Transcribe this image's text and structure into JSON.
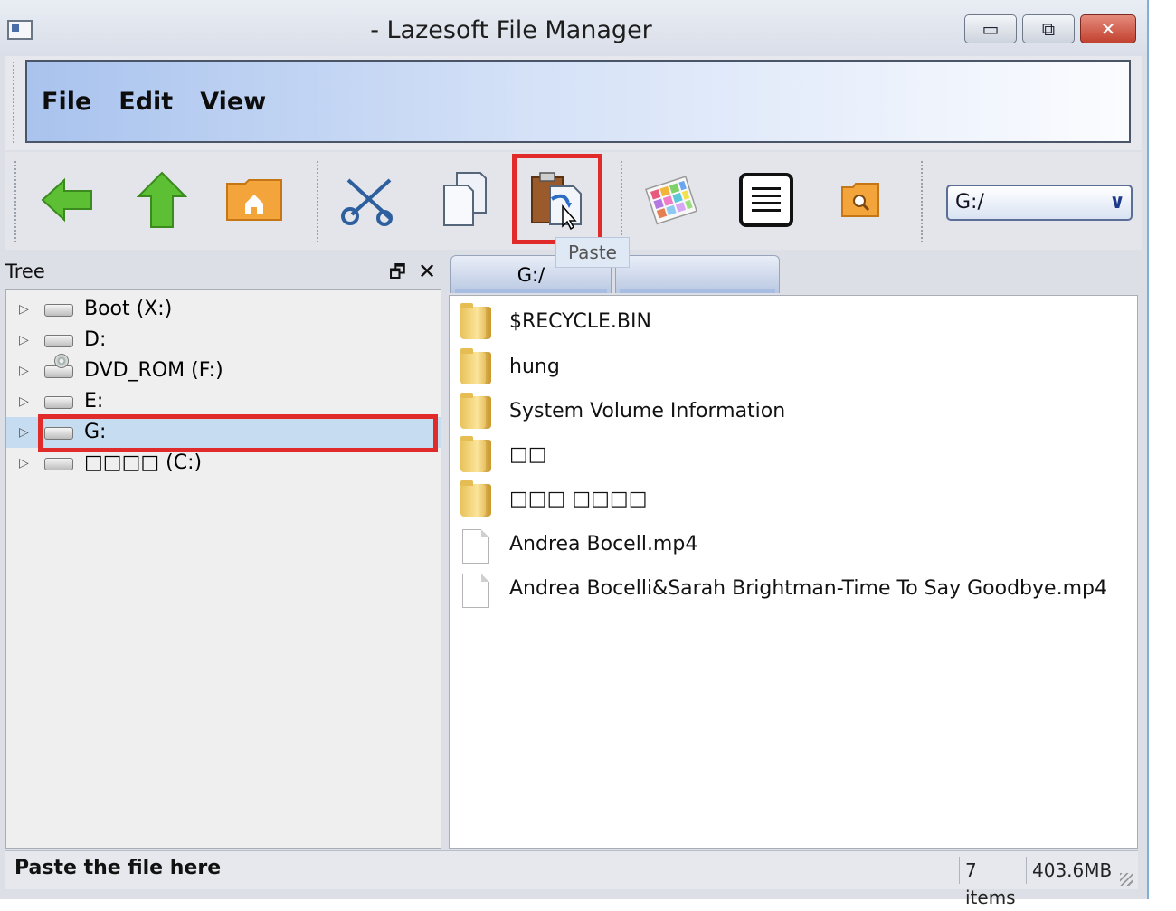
{
  "window": {
    "title": "- Lazesoft File Manager",
    "minimize_glyph": "▭",
    "maximize_glyph": "⧉",
    "close_glyph": "✕"
  },
  "menu": {
    "items": [
      "File",
      "Edit",
      "View"
    ]
  },
  "toolbar": {
    "buttons": [
      {
        "icon": "back-arrow-icon",
        "color": "#4caf2e"
      },
      {
        "icon": "up-arrow-icon",
        "color": "#4caf2e"
      },
      {
        "icon": "home-folder-icon",
        "color": "#f0a23a"
      },
      {
        "icon": "scissors-icon",
        "color": "#2b5f9e"
      },
      {
        "icon": "copy-icon",
        "color": "#dfe6f0"
      },
      {
        "icon": "paste-icon",
        "color": "#8a4b23"
      },
      {
        "icon": "color-palette-icon",
        "color": "#e86ab8"
      },
      {
        "icon": "list-view-icon",
        "color": "#111111"
      },
      {
        "icon": "search-folder-icon",
        "color": "#f0a23a"
      }
    ],
    "paste_tooltip": "Paste",
    "path_combo_value": "G:/",
    "path_combo_arrow": "∨"
  },
  "tree": {
    "header": "Tree",
    "float_glyph": "🗗",
    "close_glyph": "✕",
    "items": [
      {
        "label": "Boot (X:)",
        "icon": "hard-drive-icon"
      },
      {
        "label": "D:",
        "icon": "hard-drive-icon"
      },
      {
        "label": "DVD_ROM (F:)",
        "icon": "dvd-drive-icon"
      },
      {
        "label": "E:",
        "icon": "hard-drive-icon"
      },
      {
        "label": "G:",
        "icon": "hard-drive-icon",
        "selected": true
      },
      {
        "label": "□□□□ (C:)",
        "icon": "hard-drive-icon"
      }
    ],
    "expander_glyph": "▷"
  },
  "tabs": [
    {
      "label": "G:/"
    },
    {
      "label": ""
    }
  ],
  "files": [
    {
      "name": "$RECYCLE.BIN",
      "type": "folder"
    },
    {
      "name": "hung",
      "type": "folder"
    },
    {
      "name": "System Volume Information",
      "type": "folder"
    },
    {
      "name": "□□",
      "type": "folder"
    },
    {
      "name": "□□□ □□□□",
      "type": "folder"
    },
    {
      "name": "Andrea Bocell.mp4",
      "type": "file"
    },
    {
      "name": "Andrea Bocelli&Sarah Brightman-Time To Say Goodbye.mp4",
      "type": "file"
    }
  ],
  "status": {
    "message": "Paste the file here",
    "item_count": "7 items",
    "size": "403.6MB"
  },
  "highlight_color": "#e12a2a"
}
